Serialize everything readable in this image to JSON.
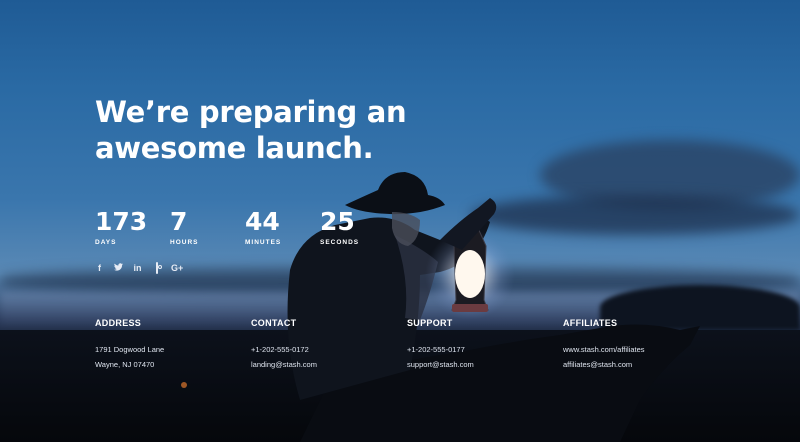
{
  "hero": {
    "headline_line1": "We’re preparing an",
    "headline_line2": "awesome launch."
  },
  "countdown": [
    {
      "value": "173",
      "label": "DAYS"
    },
    {
      "value": "7",
      "label": "HOURS"
    },
    {
      "value": "44",
      "label": "MINUTES"
    },
    {
      "value": "25",
      "label": "SECONDS"
    }
  ],
  "social": [
    {
      "name": "facebook",
      "glyph": "f"
    },
    {
      "name": "twitter",
      "glyph": "🐦"
    },
    {
      "name": "linkedin",
      "glyph": "in"
    },
    {
      "name": "instagram",
      "glyph": ""
    },
    {
      "name": "google-plus",
      "glyph": "G+"
    }
  ],
  "contact": {
    "address": {
      "heading": "ADDRESS",
      "line1": "1791 Dogwood Lane",
      "line2": "Wayne, NJ 07470"
    },
    "contact": {
      "heading": "CONTACT",
      "line1": "+1-202-555-0172",
      "line2": "landing@stash.com"
    },
    "support": {
      "heading": "SUPPORT",
      "line1": "+1-202-555-0177",
      "line2": "support@stash.com"
    },
    "affiliates": {
      "heading": "AFFILIATES",
      "line1": "www.stash.com/affiliates",
      "line2": "affiliates@stash.com"
    }
  },
  "colors": {
    "sky_top": "#1f5b95",
    "sky_mid": "#3a76ad",
    "ground": "#05080d",
    "lantern_glow": "#fff6e0",
    "text": "#ffffff"
  }
}
